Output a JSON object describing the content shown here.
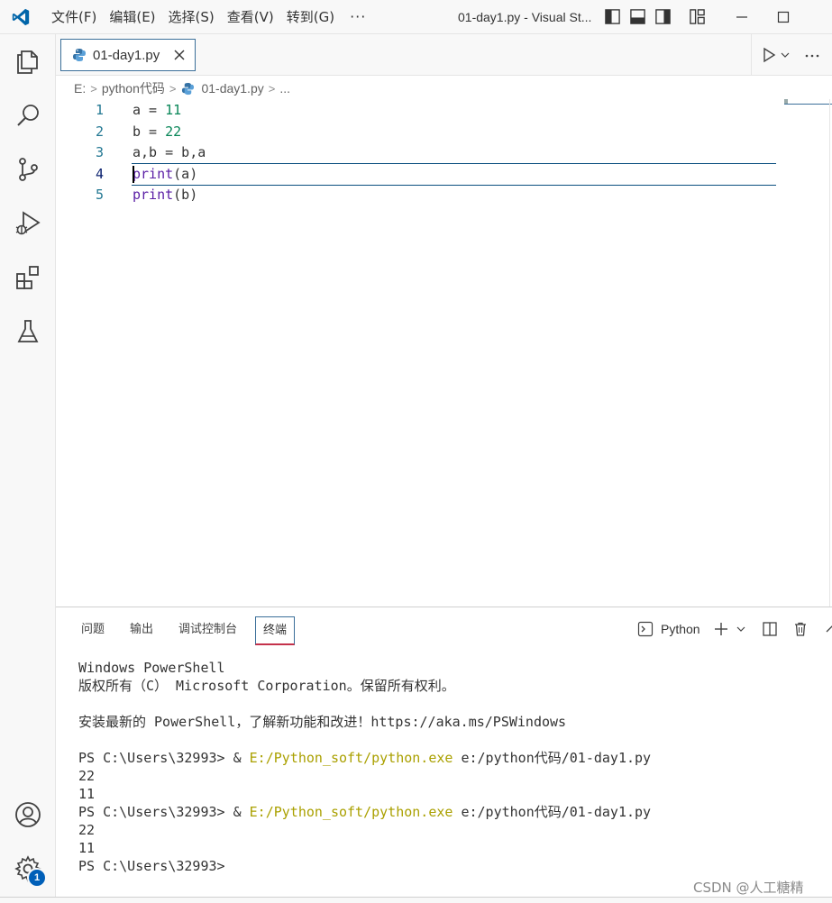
{
  "window": {
    "title": "01-day1.py - Visual St..."
  },
  "menu": [
    "文件(F)",
    "编辑(E)",
    "选择(S)",
    "查看(V)",
    "转到(G)"
  ],
  "menu_more": "···",
  "activity_bar": {
    "items": [
      "explorer-icon",
      "search-icon",
      "source-control-icon",
      "run-debug-icon",
      "extensions-icon",
      "testing-icon"
    ],
    "bottom": [
      "account-icon",
      "settings-gear-icon"
    ],
    "settings_badge": "1"
  },
  "tab": {
    "label": "01-day1.py",
    "icon": "python-icon"
  },
  "breadcrumb": {
    "drive": "E:",
    "folder": "python代码",
    "file": "01-day1.py",
    "more": "..."
  },
  "editor": {
    "lines": [
      {
        "num": "1",
        "text": "a = 11"
      },
      {
        "num": "2",
        "text": "b = 22"
      },
      {
        "num": "3",
        "text": "a,b = b,a"
      },
      {
        "num": "4",
        "text": "print(a)"
      },
      {
        "num": "5",
        "text": "print(b)"
      }
    ]
  },
  "panel": {
    "tabs": [
      "问题",
      "输出",
      "调试控制台",
      "终端"
    ],
    "active_tab": "终端",
    "shell_label": "Python"
  },
  "terminal": {
    "header": [
      "Windows PowerShell",
      "版权所有（C） Microsoft Corporation。保留所有权利。"
    ],
    "tip": "安装最新的 PowerShell，了解新功能和改进！https://aka.ms/PSWindows",
    "prompt": "PS C:\\Users\\32993>",
    "amp": "&",
    "exe": "E:/Python_soft/python.exe",
    "script": "e:/python代码/01-day1.py",
    "out1": "22",
    "out2": "11"
  },
  "watermark": "CSDN @人工糖精",
  "colors": {
    "accent": "#005fb8",
    "line_number": "#237893",
    "number_literal": "#098658",
    "terminal_exe": "#aaa000"
  }
}
